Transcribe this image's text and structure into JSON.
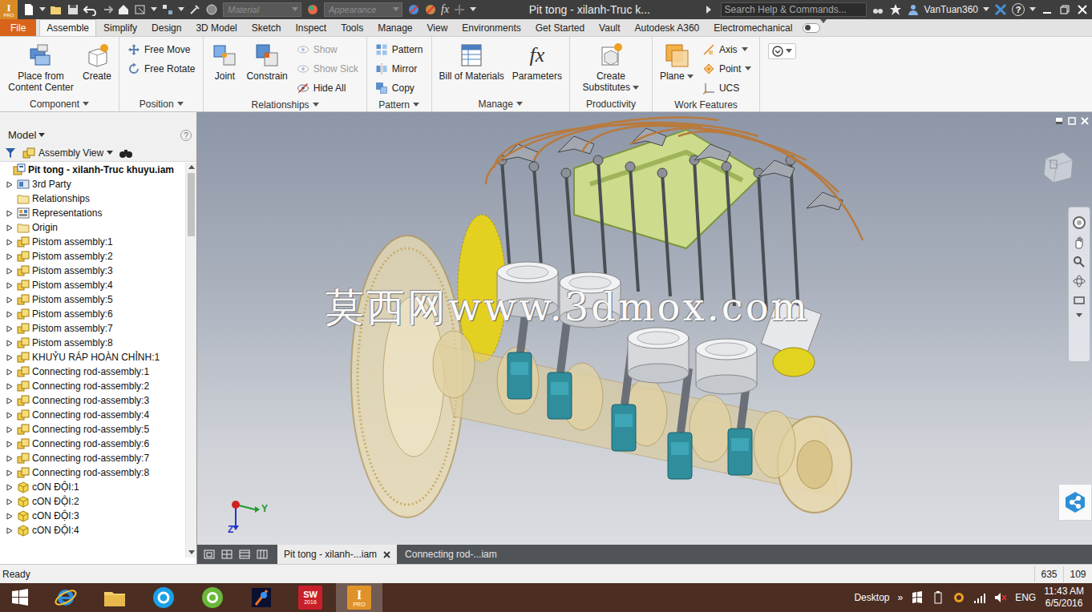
{
  "app_logo": {
    "text": "I",
    "sub": "PRO"
  },
  "title_bar": {
    "material": "Material",
    "appearance": "Appearance",
    "fx": "fx",
    "title": "Pit tong - xilanh-Truc k...",
    "search_placeholder": "Search Help & Commands...",
    "user": "VanTuan360",
    "help": "?"
  },
  "ribbon_tabs": [
    {
      "label": "File",
      "kind": "file",
      "selected": false
    },
    {
      "label": "Assemble",
      "kind": "tab",
      "selected": true
    },
    {
      "label": "Simplify",
      "kind": "tab",
      "selected": false
    },
    {
      "label": "Design",
      "kind": "tab",
      "selected": false
    },
    {
      "label": "3D Model",
      "kind": "tab",
      "selected": false
    },
    {
      "label": "Sketch",
      "kind": "tab",
      "selected": false
    },
    {
      "label": "Inspect",
      "kind": "tab",
      "selected": false
    },
    {
      "label": "Tools",
      "kind": "tab",
      "selected": false
    },
    {
      "label": "Manage",
      "kind": "tab",
      "selected": false
    },
    {
      "label": "View",
      "kind": "tab",
      "selected": false
    },
    {
      "label": "Environments",
      "kind": "tab",
      "selected": false
    },
    {
      "label": "Get Started",
      "kind": "tab",
      "selected": false
    },
    {
      "label": "Vault",
      "kind": "tab",
      "selected": false
    },
    {
      "label": "Autodesk A360",
      "kind": "tab",
      "selected": false
    },
    {
      "label": "Electromechanical",
      "kind": "tab",
      "selected": false
    }
  ],
  "ribbon_panels": [
    {
      "title": "Component",
      "dropdown": true,
      "tools": [
        {
          "label": "Place from Content Center",
          "kind": "large",
          "disabled": false,
          "dropdown": false,
          "icon_text": ""
        },
        {
          "label": "Create",
          "kind": "large",
          "disabled": false,
          "dropdown": false,
          "icon_text": ""
        }
      ]
    },
    {
      "title": "Position",
      "dropdown": true,
      "tools": [
        {
          "label": "Free Move",
          "kind": "small",
          "disabled": false,
          "dropdown": false,
          "icon_text": ""
        },
        {
          "label": "Free Rotate",
          "kind": "small",
          "disabled": false,
          "dropdown": false,
          "icon_text": ""
        }
      ]
    },
    {
      "title": "Relationships",
      "dropdown": true,
      "tools": [
        {
          "label": "Joint",
          "kind": "large",
          "disabled": false,
          "dropdown": false,
          "icon_text": ""
        },
        {
          "label": "Constrain",
          "kind": "large",
          "disabled": false,
          "dropdown": false,
          "icon_text": ""
        },
        {
          "label": "Show",
          "kind": "small",
          "disabled": true,
          "dropdown": false,
          "icon_text": ""
        },
        {
          "label": "Show Sick",
          "kind": "small",
          "disabled": true,
          "dropdown": false,
          "icon_text": ""
        },
        {
          "label": "Hide All",
          "kind": "small",
          "disabled": false,
          "dropdown": false,
          "icon_text": ""
        }
      ]
    },
    {
      "title": "Pattern",
      "dropdown": true,
      "tools": [
        {
          "label": "Pattern",
          "kind": "small",
          "disabled": false,
          "dropdown": false,
          "icon_text": ""
        },
        {
          "label": "Mirror",
          "kind": "small",
          "disabled": false,
          "dropdown": false,
          "icon_text": ""
        },
        {
          "label": "Copy",
          "kind": "small",
          "disabled": false,
          "dropdown": false,
          "icon_text": ""
        }
      ]
    },
    {
      "title": "Manage",
      "dropdown": true,
      "tools": [
        {
          "label": "Bill of Materials",
          "kind": "large",
          "disabled": false,
          "dropdown": false,
          "icon_text": ""
        },
        {
          "label": "Parameters",
          "kind": "large",
          "disabled": false,
          "dropdown": false,
          "icon_text": "fx"
        }
      ]
    },
    {
      "title": "Productivity",
      "dropdown": false,
      "tools": [
        {
          "label": "Create Substitutes",
          "kind": "large",
          "disabled": false,
          "dropdown": true,
          "icon_text": ""
        }
      ]
    },
    {
      "title": "Work Features",
      "dropdown": false,
      "tools": [
        {
          "label": "Plane",
          "kind": "large",
          "disabled": false,
          "dropdown": true,
          "icon_text": ""
        },
        {
          "label": "Axis",
          "kind": "small",
          "disabled": false,
          "dropdown": true,
          "icon_text": ""
        },
        {
          "label": "Point",
          "kind": "small",
          "disabled": false,
          "dropdown": true,
          "icon_text": ""
        },
        {
          "label": "UCS",
          "kind": "small",
          "disabled": false,
          "dropdown": false,
          "icon_text": ""
        }
      ]
    }
  ],
  "browser": {
    "title": "Model",
    "help": "?",
    "view": "Assembly View",
    "root": "Pit tong - xilanh-Truc khuyu.iam",
    "scroll_level": 0.17,
    "items": [
      {
        "label": "3rd Party",
        "kind": "thirdparty",
        "expandable": true
      },
      {
        "label": "Relationships",
        "kind": "folder",
        "expandable": false
      },
      {
        "label": "Representations",
        "kind": "representations",
        "expandable": true
      },
      {
        "label": "Origin",
        "kind": "folder",
        "expandable": true
      },
      {
        "label": "Pistom assembly:1",
        "kind": "assembly",
        "expandable": true
      },
      {
        "label": "Pistom assembly:2",
        "kind": "assembly",
        "expandable": true
      },
      {
        "label": "Pistom assembly:3",
        "kind": "assembly",
        "expandable": true
      },
      {
        "label": "Pistom assembly:4",
        "kind": "assembly",
        "expandable": true
      },
      {
        "label": "Pistom assembly:5",
        "kind": "assembly",
        "expandable": true
      },
      {
        "label": "Pistom assembly:6",
        "kind": "assembly",
        "expandable": true
      },
      {
        "label": "Pistom assembly:7",
        "kind": "assembly",
        "expandable": true
      },
      {
        "label": "Pistom assembly:8",
        "kind": "assembly",
        "expandable": true
      },
      {
        "label": "KHUỶU RÁP HOÀN CHỈNH:1",
        "kind": "assembly",
        "expandable": true
      },
      {
        "label": "Connecting rod-assembly:1",
        "kind": "assembly",
        "expandable": true
      },
      {
        "label": "Connecting rod-assembly:2",
        "kind": "assembly",
        "expandable": true
      },
      {
        "label": "Connecting rod-assembly:3",
        "kind": "assembly",
        "expandable": true
      },
      {
        "label": "Connecting rod-assembly:4",
        "kind": "assembly",
        "expandable": true
      },
      {
        "label": "Connecting rod-assembly:5",
        "kind": "assembly",
        "expandable": true
      },
      {
        "label": "Connecting rod-assembly:6",
        "kind": "assembly",
        "expandable": true
      },
      {
        "label": "Connecting rod-assembly:7",
        "kind": "assembly",
        "expandable": true
      },
      {
        "label": "Connecting rod-assembly:8",
        "kind": "assembly",
        "expandable": true
      },
      {
        "label": "cON ĐỘI:1",
        "kind": "part",
        "expandable": true
      },
      {
        "label": "cON ĐỘI:2",
        "kind": "part",
        "expandable": true
      },
      {
        "label": "cON ĐỘI:3",
        "kind": "part",
        "expandable": true
      },
      {
        "label": "cON ĐỘI:4",
        "kind": "part",
        "expandable": true
      }
    ]
  },
  "viewport": {
    "watermark": "莫西网www.3dmox.com",
    "axes": [
      {
        "label": "Y",
        "color": "#1f9a2a"
      },
      {
        "label": "Z",
        "color": "#2233cc"
      }
    ]
  },
  "doc_tabs": [
    {
      "label": "Pit tong - xilanh-...iam",
      "selected": true,
      "closable": true
    },
    {
      "label": "Connecting rod-...iam",
      "selected": false,
      "closable": false
    }
  ],
  "status_bar": {
    "text": "Ready",
    "cells": [
      "635",
      "109"
    ]
  },
  "taskbar": {
    "apps": [
      {
        "kind": "ie",
        "text": "",
        "sub": "",
        "selected": false
      },
      {
        "kind": "explorer",
        "text": "",
        "sub": "",
        "selected": false
      },
      {
        "kind": "skype",
        "text": "",
        "sub": "",
        "selected": false
      },
      {
        "kind": "green",
        "text": "",
        "sub": "",
        "selected": false
      },
      {
        "kind": "media",
        "text": "",
        "sub": "",
        "selected": false
      },
      {
        "kind": "solidworks",
        "text": "SW",
        "sub": "2016",
        "selected": false
      },
      {
        "kind": "inventor",
        "text": "I",
        "sub": "PRO",
        "selected": true
      }
    ],
    "desktop": "Desktop",
    "more": "»",
    "language": "ENG",
    "time": "11:43 AM",
    "date": "6/5/2016"
  }
}
